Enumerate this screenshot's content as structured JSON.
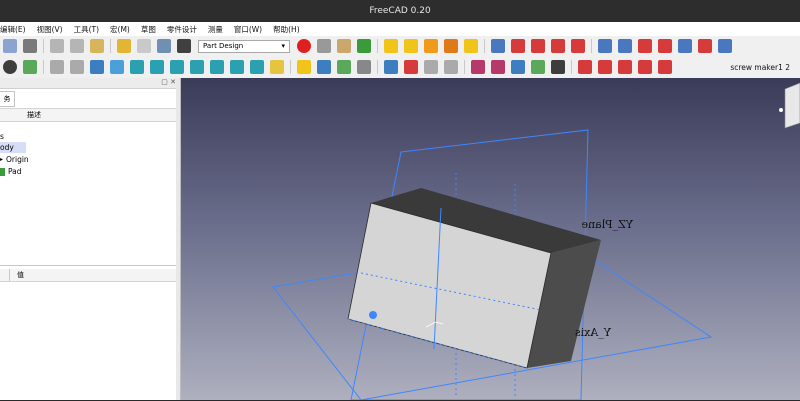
{
  "window": {
    "title": "FreeCAD 0.20"
  },
  "menu": [
    "编辑(E)",
    "视图(V)",
    "工具(T)",
    "宏(M)",
    "草图",
    "零件设计",
    "测量",
    "窗口(W)",
    "帮助(H)"
  ],
  "toolbar": {
    "workbench": "Part Design",
    "macro_label": "screw maker1 2"
  },
  "left_panel": {
    "tab_label": "务",
    "column_header": "描述",
    "tree": [
      "s",
      "ody",
      "Origin",
      "Pad"
    ]
  },
  "properties": {
    "header_left": "",
    "header_right": "值"
  },
  "viewport": {
    "plane_label": "YZ_Plane",
    "axis_label": "Y_Axis"
  },
  "colors": {
    "title_bg": "#2d2d2d",
    "viewport_top": "#3a3b58",
    "viewport_bottom": "#aeb0bf",
    "plane_blue": "#3f86ff",
    "box_front": "#d5d5d5",
    "box_top": "#3a3a3a",
    "box_side": "#4c4c4c",
    "selection": "#d5ddf7"
  }
}
